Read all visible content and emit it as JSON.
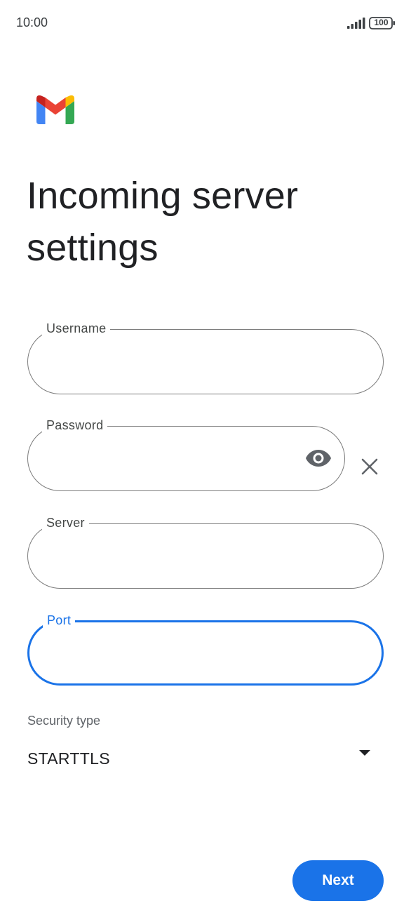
{
  "status_bar": {
    "time": "10:00",
    "battery": "100",
    "icons": [
      "signal-icon",
      "battery-icon"
    ]
  },
  "app": {
    "logo": "gmail-logo",
    "colors": {
      "accent": "#1a73e8",
      "outline": "#7b7b7b",
      "text": "#202124"
    }
  },
  "page": {
    "title": "Incoming server settings"
  },
  "form": {
    "username": {
      "label": "Username",
      "value": ""
    },
    "password": {
      "label": "Password",
      "value": "",
      "icons": [
        "eye-icon",
        "close-icon"
      ]
    },
    "server": {
      "label": "Server",
      "value": ""
    },
    "port": {
      "label": "Port",
      "value": "",
      "focused": true
    },
    "security_type": {
      "label": "Security type",
      "selected": "STARTTLS",
      "icon": "dropdown-arrow-icon"
    }
  },
  "actions": {
    "next_label": "Next"
  }
}
